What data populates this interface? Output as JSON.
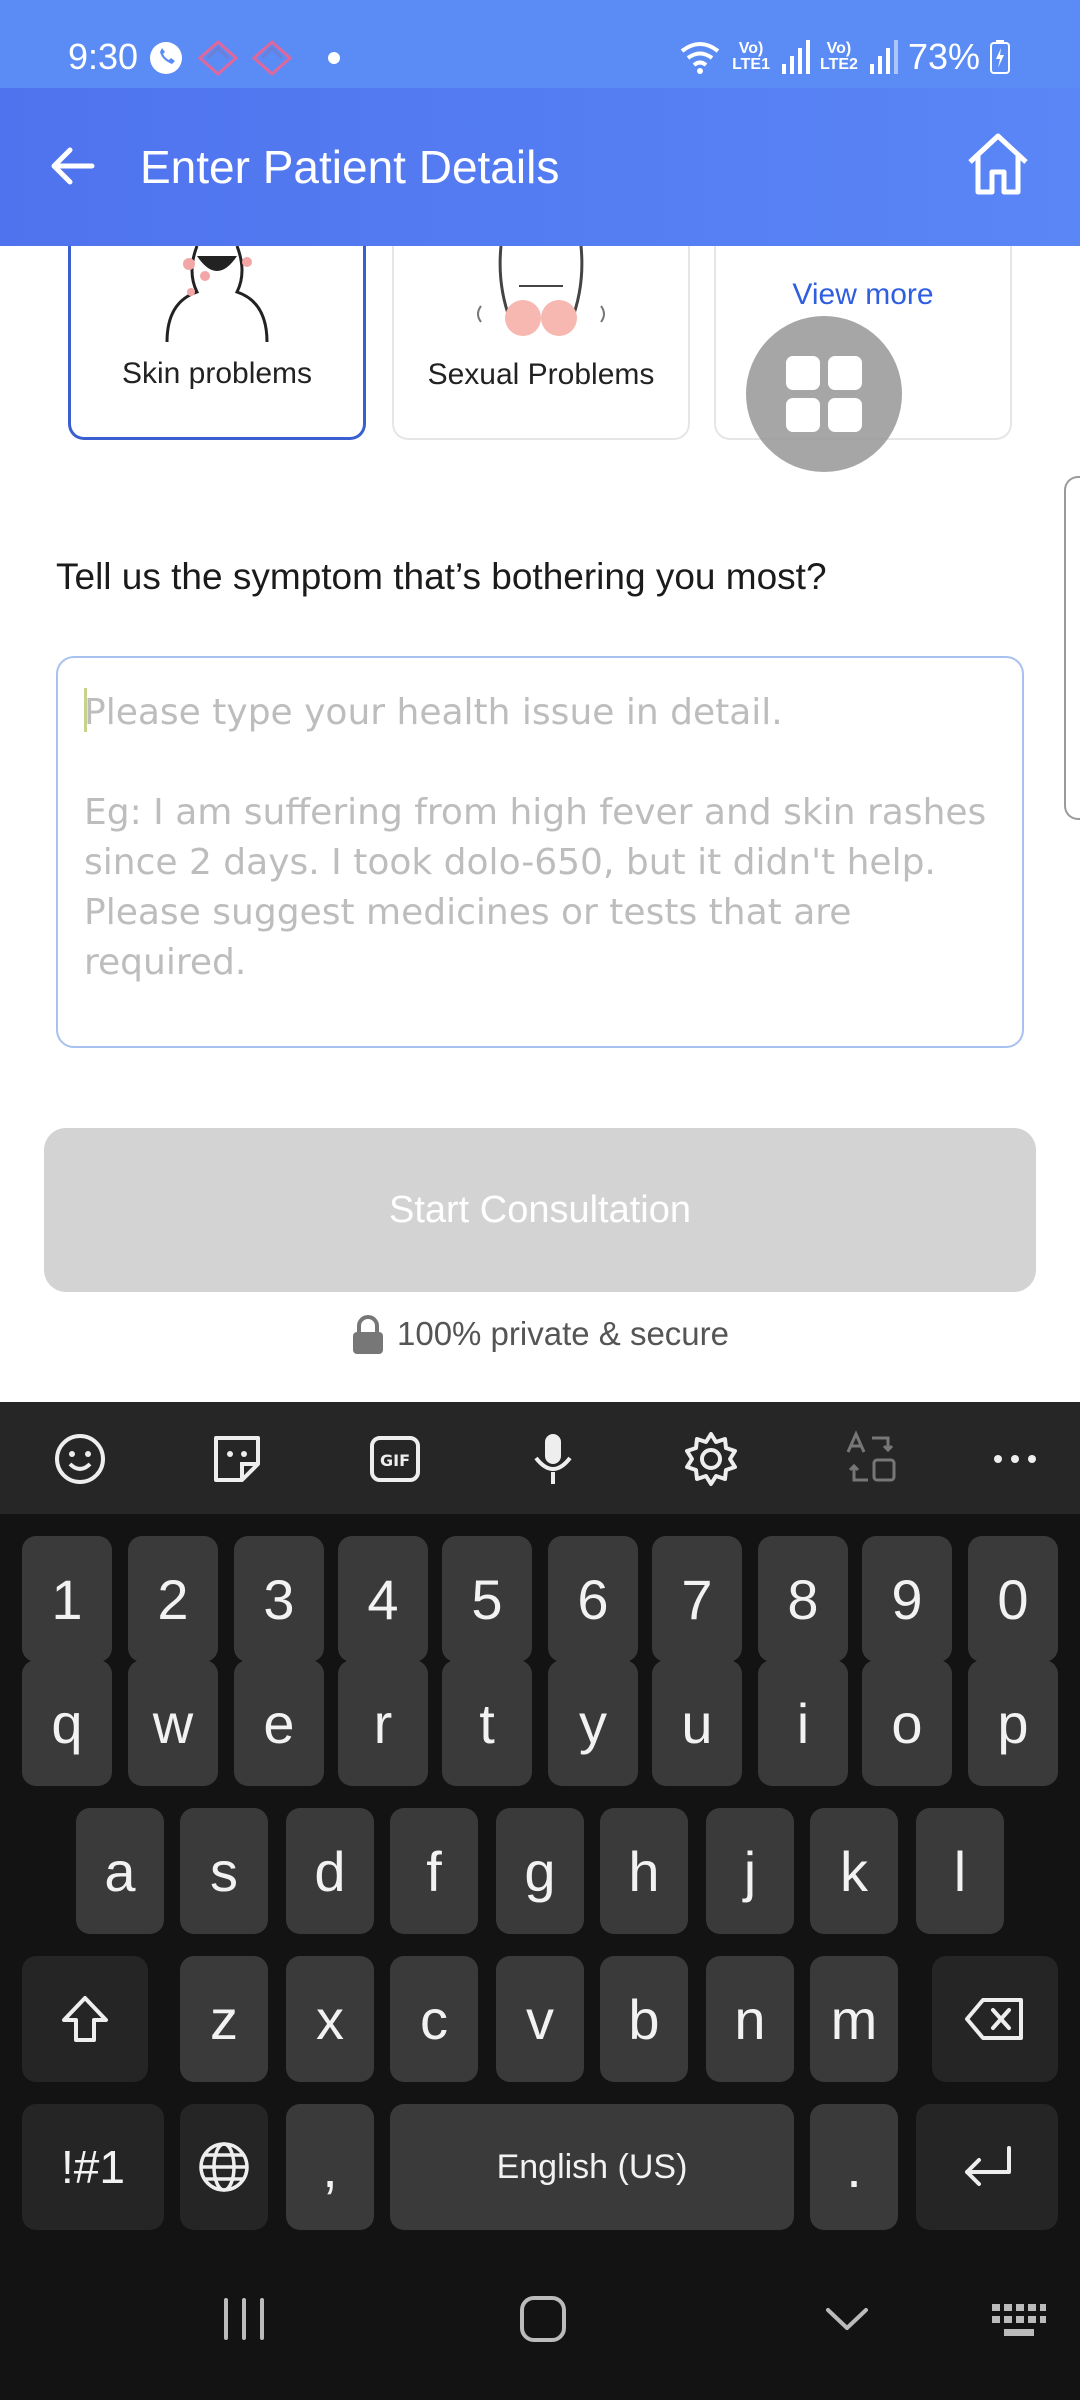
{
  "status_bar": {
    "time": "9:30",
    "battery": "73%",
    "lte1": "LTE1",
    "lte2": "LTE2"
  },
  "app_bar": {
    "title": "Enter Patient Details"
  },
  "categories": [
    {
      "label": "Skin problems",
      "selected": true
    },
    {
      "label": "Sexual Problems",
      "selected": false
    },
    {
      "label": "View more",
      "selected": false
    }
  ],
  "form": {
    "question": "Tell us the symptom that’s bothering you most?",
    "placeholder_line1": "Please type your health issue in detail.",
    "placeholder_example": "Eg: I am suffering from high fever and skin rashes since 2 days. I took dolo-650, but it didn't help. Please suggest medicines or tests that are required.",
    "value": ""
  },
  "start_button": {
    "label": "Start Consultation",
    "enabled": false
  },
  "privacy_note": "100% private & secure",
  "keyboard": {
    "number_row": [
      "1",
      "2",
      "3",
      "4",
      "5",
      "6",
      "7",
      "8",
      "9",
      "0"
    ],
    "row1": [
      "q",
      "w",
      "e",
      "r",
      "t",
      "y",
      "u",
      "i",
      "o",
      "p"
    ],
    "row2": [
      "a",
      "s",
      "d",
      "f",
      "g",
      "h",
      "j",
      "k",
      "l"
    ],
    "row3": [
      "z",
      "x",
      "c",
      "v",
      "b",
      "n",
      "m"
    ],
    "symbols_key": "!#1",
    "comma_key": ",",
    "space_key": "English (US)",
    "period_key": "."
  },
  "colors": {
    "primary": "#4f73ee",
    "selected_border": "#3a5fcf",
    "link": "#2f5ee0",
    "disabled_button": "#d3d3d3"
  }
}
